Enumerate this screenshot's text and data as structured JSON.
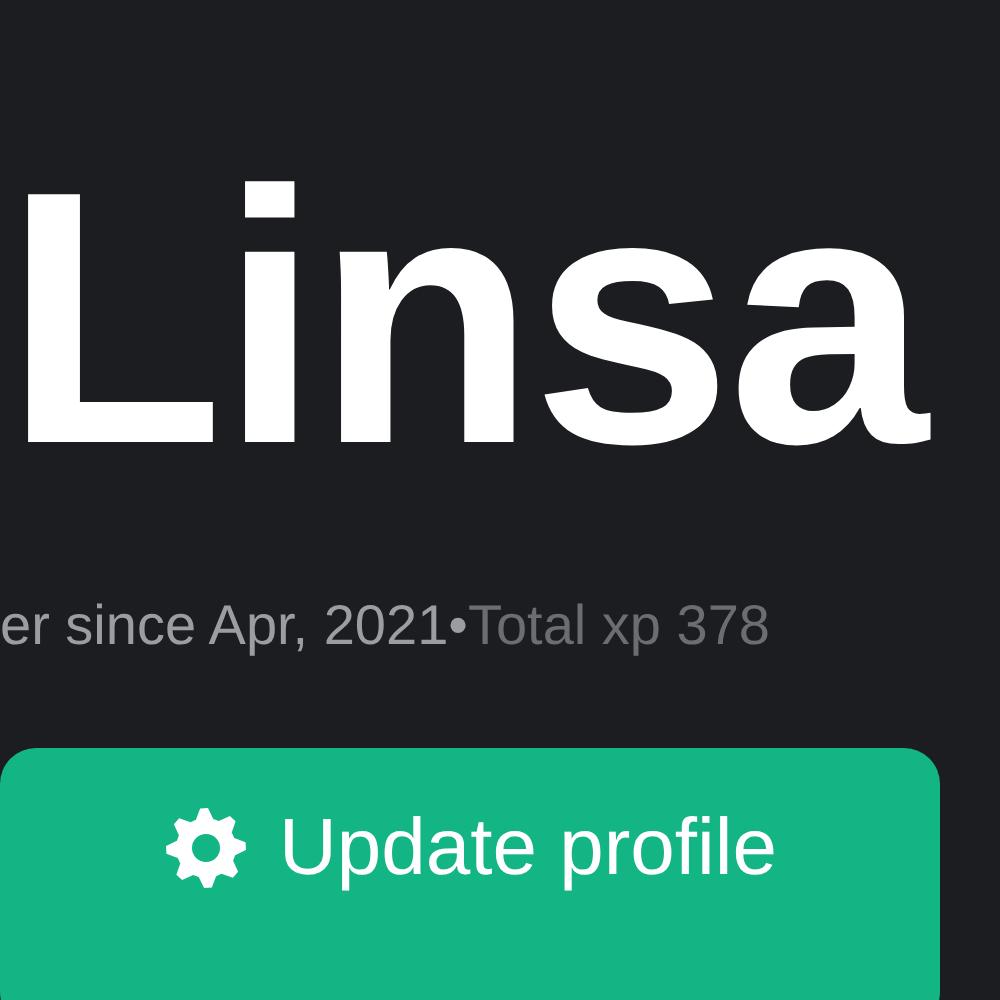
{
  "profile": {
    "name": "Linsa",
    "meta": [
      {
        "kind": "since",
        "text": "er since Apr, 2021"
      },
      {
        "kind": "separator",
        "text": "•"
      },
      {
        "kind": "xp",
        "text": "Total xp 378"
      }
    ],
    "button": {
      "label": "Update profile"
    }
  }
}
